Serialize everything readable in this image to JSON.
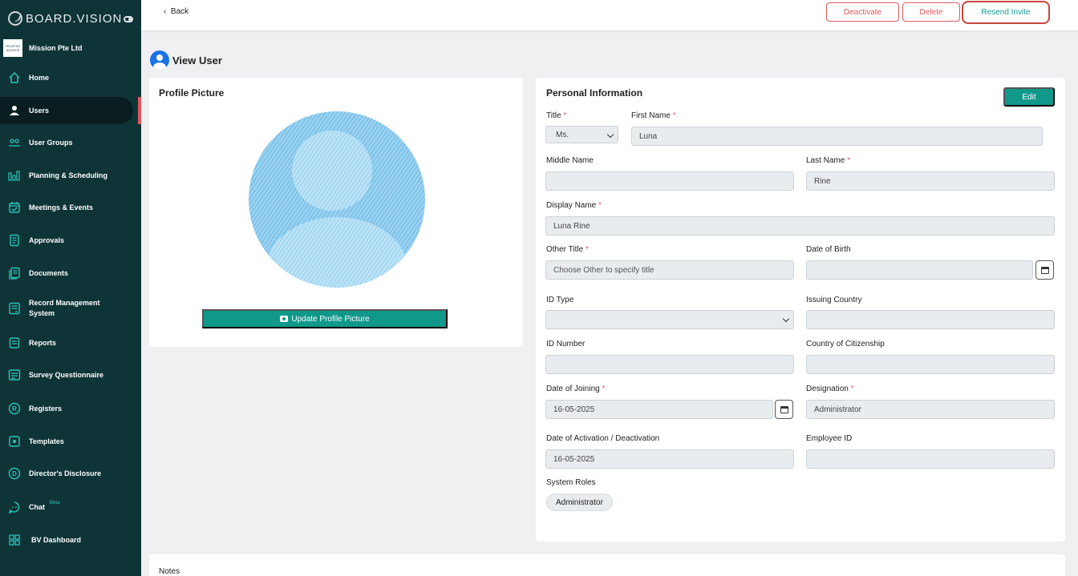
{
  "brand": {
    "name": "BOARD.VISION"
  },
  "org": {
    "logo_text": "TRUSTED SOURCE",
    "name": "Mission Pte Ltd"
  },
  "nav": [
    {
      "label": "Home",
      "icon": "home-icon"
    },
    {
      "label": "Users",
      "icon": "user-icon",
      "active": true
    },
    {
      "label": "User Groups",
      "icon": "user-groups-icon"
    },
    {
      "label": "Planning & Scheduling",
      "icon": "planning-icon"
    },
    {
      "label": "Meetings & Events",
      "icon": "calendar-icon"
    },
    {
      "label": "Approvals",
      "icon": "approvals-icon"
    },
    {
      "label": "Documents",
      "icon": "documents-icon"
    },
    {
      "label": "Record Management System",
      "icon": "records-icon"
    },
    {
      "label": "Reports",
      "icon": "reports-icon"
    },
    {
      "label": "Survey Questionnaire",
      "icon": "survey-icon"
    },
    {
      "label": "Registers",
      "icon": "registers-icon"
    },
    {
      "label": "Templates",
      "icon": "templates-icon"
    },
    {
      "label": "Director's Disclosure",
      "icon": "disclosure-icon"
    },
    {
      "label": "Chat",
      "icon": "chat-icon",
      "badge": "Beta"
    },
    {
      "label": "BV Dashboard",
      "icon": "dashboard-icon"
    }
  ],
  "topbar": {
    "back": "Back",
    "deactivate": "Deactivate",
    "delete": "Delete",
    "resend": "Resend Invite"
  },
  "page": {
    "title": "View User"
  },
  "profile": {
    "title": "Profile Picture",
    "update_button": "Update Profile Picture"
  },
  "personal": {
    "title": "Personal Information",
    "edit": "Edit",
    "fields": {
      "title": {
        "label": "Title",
        "value": "Ms."
      },
      "first_name": {
        "label": "First Name",
        "value": "Luna"
      },
      "middle_name": {
        "label": "Middle Name",
        "value": ""
      },
      "last_name": {
        "label": "Last Name",
        "value": "Rine"
      },
      "display_name": {
        "label": "Display Name",
        "value": "Luna Rine"
      },
      "other_title": {
        "label": "Other Title",
        "placeholder": "Choose Other to specify title"
      },
      "date_of_birth": {
        "label": "Date of Birth",
        "value": ""
      },
      "id_type": {
        "label": "ID Type",
        "value": ""
      },
      "issuing_country": {
        "label": "Issuing Country",
        "value": ""
      },
      "id_number": {
        "label": "ID Number",
        "value": ""
      },
      "citizenship": {
        "label": "Country of Citizenship",
        "value": ""
      },
      "date_of_joining": {
        "label": "Date of Joining",
        "value": "16-05-2025"
      },
      "designation": {
        "label": "Designation",
        "value": "Administrator"
      },
      "activation_date": {
        "label": "Date of Activation / Deactivation",
        "value": "16-05-2025"
      },
      "employee_id": {
        "label": "Employee ID",
        "value": ""
      }
    },
    "system_roles": {
      "label": "System Roles",
      "roles": [
        "Administrator"
      ]
    }
  },
  "notes": {
    "label": "Notes"
  },
  "colors": {
    "sidebar": "#0f3438",
    "accent": "#10998a",
    "danger": "#e05a5a",
    "primary_blue": "#1a73e8"
  }
}
